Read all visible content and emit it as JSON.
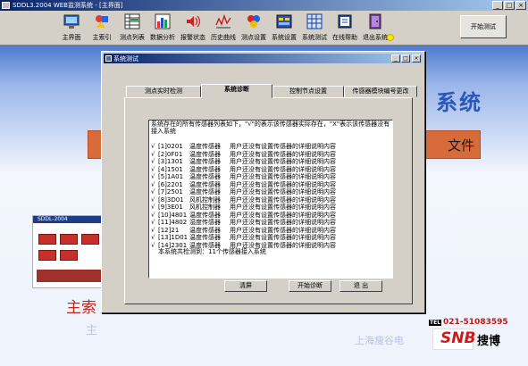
{
  "window": {
    "title": "SDDL3.2004 WEB监测系统 - [主界面]",
    "controls": [
      "_",
      "□",
      "×"
    ]
  },
  "toolbar": {
    "items": [
      {
        "label": "主界面",
        "icon": "home-screen-icon"
      },
      {
        "label": "主索引",
        "icon": "shapes-icon"
      },
      {
        "label": "测点列表",
        "icon": "list-table-icon"
      },
      {
        "label": "数据分析",
        "icon": "bar-chart-icon"
      },
      {
        "label": "报警状态",
        "icon": "alarm-sound-icon"
      },
      {
        "label": "历史曲线",
        "icon": "curve-icon"
      },
      {
        "label": "测点设置",
        "icon": "color-balls-icon"
      },
      {
        "label": "系统设置",
        "icon": "settings-board-icon"
      },
      {
        "label": "系统测试",
        "icon": "test-grid-icon"
      },
      {
        "label": "在线帮助",
        "icon": "help-book-icon"
      },
      {
        "label": "退出系统",
        "icon": "exit-door-icon"
      }
    ],
    "start_button": "开始测试"
  },
  "background": {
    "title_fragment": "系统",
    "file_fragment": "文件",
    "thumbnail_caption": "SDDL-2004",
    "main_fragment": "主索",
    "main_fragment2": "主",
    "footer_fragment": "上海瘦谷电",
    "tel_label": "TEL",
    "tel_number": "021-51083595",
    "logo_mark": "SNB",
    "logo_name": "搜博"
  },
  "dialog": {
    "title": "系统测试",
    "tabs": [
      "测点实时检测",
      "系统诊断",
      "控制节点设置",
      "传感器模块编号更改"
    ],
    "active_tab": 1,
    "intro": "系统存在的所有传感器列表如下，\"√\"的表示该传感器实际存在，\"X\"表示该传感器没有接入系统",
    "rows": [
      {
        "check": "√",
        "code": "[1]0201",
        "type": "温度传感器",
        "desc": "用户还没有设置传感器的详细说明内容"
      },
      {
        "check": "√",
        "code": "[2]0F01",
        "type": "温度传感器",
        "desc": "用户还没有设置传感器的详细说明内容"
      },
      {
        "check": "√",
        "code": "[3]1301",
        "type": "温度传感器",
        "desc": "用户还没有设置传感器的详细说明内容"
      },
      {
        "check": "√",
        "code": "[4]1501",
        "type": "温度传感器",
        "desc": "用户还没有设置传感器的详细说明内容"
      },
      {
        "check": "√",
        "code": "[5]1A01",
        "type": "温度传感器",
        "desc": "用户还没有设置传感器的详细说明内容"
      },
      {
        "check": "√",
        "code": "[6]2201",
        "type": "温度传感器",
        "desc": "用户还没有设置传感器的详细说明内容"
      },
      {
        "check": "√",
        "code": "[7]2501",
        "type": "温度传感器",
        "desc": "用户还没有设置传感器的详细说明内容"
      },
      {
        "check": "√",
        "code": "[8]3D01",
        "type": "风机控制器",
        "desc": "用户还没有设置传感器的详细说明内容"
      },
      {
        "check": "√",
        "code": "[9]3E01",
        "type": "风机控制器",
        "desc": "用户还没有设置传感器的详细说明内容"
      },
      {
        "check": "√",
        "code": "[10]4801",
        "type": "温度传感器",
        "desc": "用户还没有设置传感器的详细说明内容"
      },
      {
        "check": "√",
        "code": "[11]4802",
        "type": "湿度传感器",
        "desc": "用户还没有设置传感器的详细说明内容"
      },
      {
        "check": "√",
        "code": "[12]21",
        "type": "温度传感器",
        "desc": "用户还没有设置传感器的详细说明内容"
      },
      {
        "check": "√",
        "code": "[13]1D01",
        "type": "温度传感器",
        "desc": "用户还没有设置传感器的详细说明内容"
      },
      {
        "check": "√",
        "code": "[14]2301",
        "type": "温度传感器",
        "desc": "用户还没有设置传感器的详细说明内容"
      }
    ],
    "summary": "本系统共检测到：11个传感器接入系统",
    "buttons": {
      "clear": "清屏",
      "start": "开始诊断",
      "exit": "退 出"
    }
  }
}
